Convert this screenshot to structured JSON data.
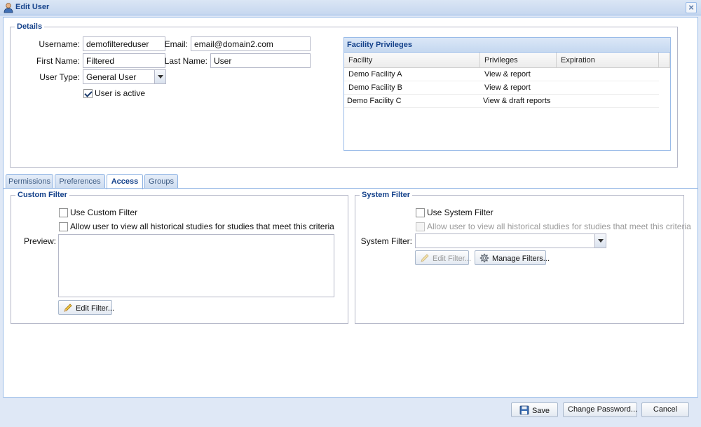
{
  "window": {
    "title": "Edit User",
    "title_icon": "user-icon",
    "close_icon": "close-icon",
    "close_glyph": "×"
  },
  "details": {
    "legend": "Details",
    "username_label": "Username:",
    "username_value": "demofiltereduser",
    "email_label": "Email:",
    "email_value": "email@domain2.com",
    "first_name_label": "First Name:",
    "first_name_value": "Filtered",
    "last_name_label": "Last Name:",
    "last_name_value": "User",
    "user_type_label": "User Type:",
    "user_type_value": "General User",
    "active_label": "User is active",
    "active_checked": true
  },
  "facility_privileges": {
    "title": "Facility Privileges",
    "columns": [
      "Facility",
      "Privileges",
      "Expiration"
    ],
    "rows": [
      {
        "facility": "Demo Facility A",
        "privileges": "View & report",
        "expiration": ""
      },
      {
        "facility": "Demo Facility B",
        "privileges": "View & report",
        "expiration": ""
      },
      {
        "facility": "Demo Facility C",
        "privileges": "View & draft reports",
        "expiration": ""
      }
    ]
  },
  "tabs": [
    {
      "label": "Permissions",
      "active": false
    },
    {
      "label": "Preferences",
      "active": false
    },
    {
      "label": "Access",
      "active": true
    },
    {
      "label": "Groups",
      "active": false
    }
  ],
  "custom_filter": {
    "legend": "Custom Filter",
    "use_label": "Use Custom Filter",
    "use_checked": false,
    "historical_label": "Allow user to view all historical studies for studies that meet this criteria",
    "historical_checked": false,
    "preview_label": "Preview:",
    "preview_value": "",
    "edit_button": "Edit Filter..."
  },
  "system_filter": {
    "legend": "System Filter",
    "use_label": "Use System Filter",
    "use_checked": false,
    "historical_label": "Allow user to view all historical studies for studies that meet this criteria",
    "historical_disabled": true,
    "filter_label": "System Filter:",
    "filter_value": "",
    "edit_button": "Edit Filter...",
    "manage_button": "Manage Filters..."
  },
  "footer": {
    "save_button": "Save",
    "change_password_button": "Change Password...",
    "cancel_button": "Cancel"
  },
  "colors": {
    "accent": "#15428b",
    "border": "#99bbe8",
    "frame_bg": "#dfe8f6"
  }
}
